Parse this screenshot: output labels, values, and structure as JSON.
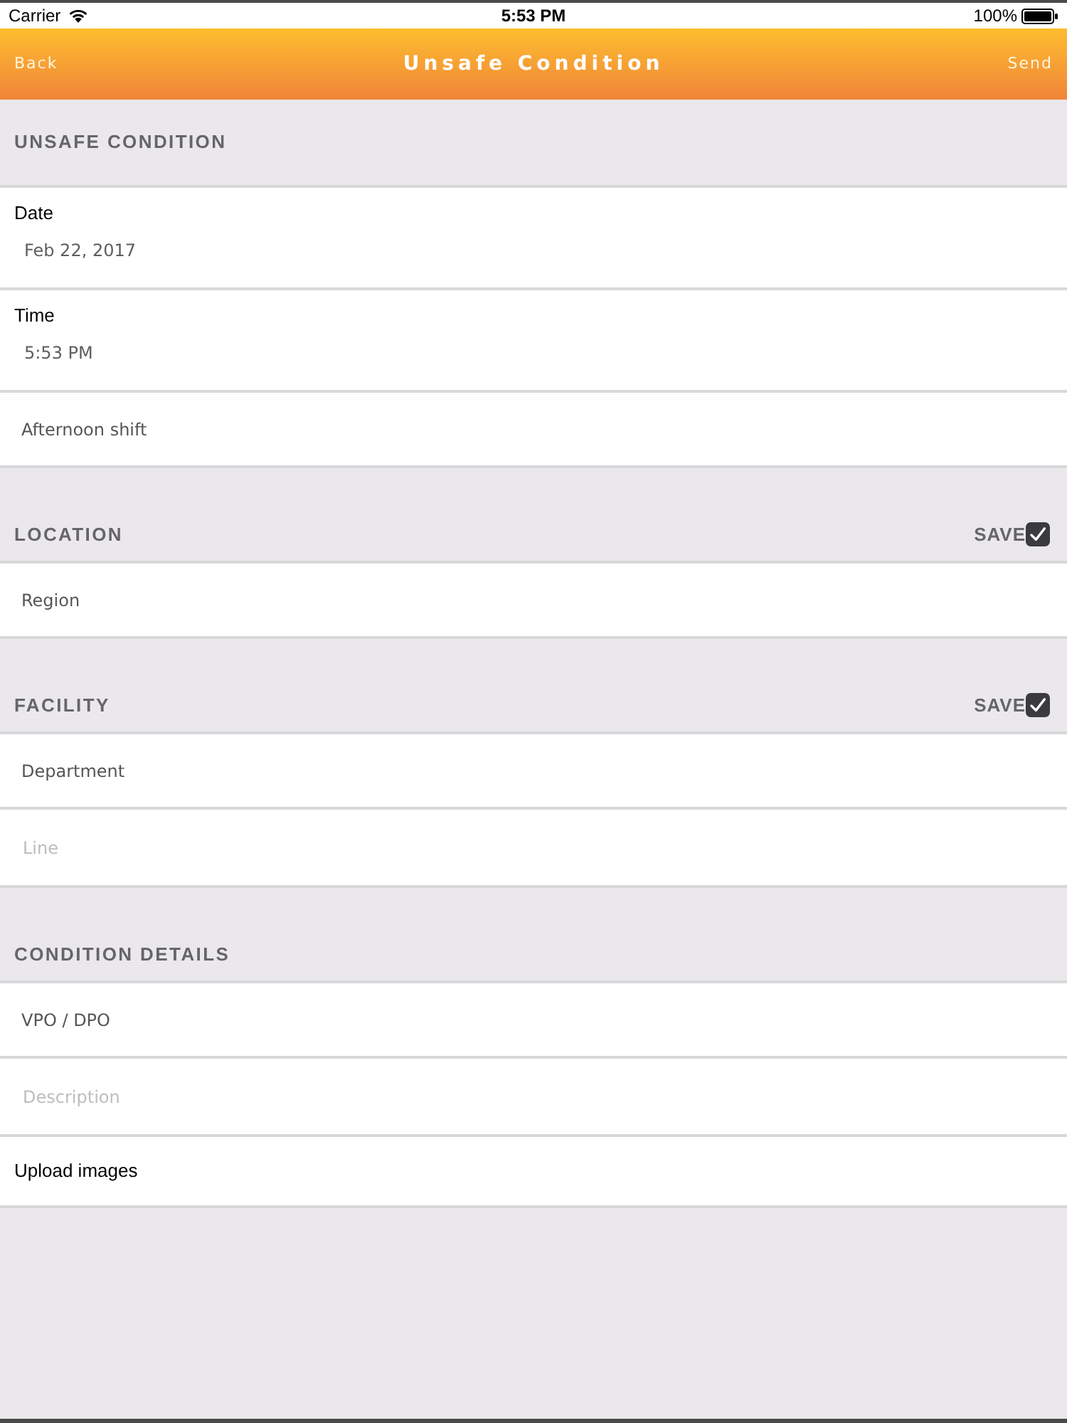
{
  "status_bar": {
    "carrier": "Carrier",
    "time": "5:53 PM",
    "battery": "100%"
  },
  "nav_bar": {
    "back": "Back",
    "title": "Unsafe Condition",
    "send": "Send"
  },
  "sections": [
    {
      "title": "UNSAFE CONDITION",
      "rows": [
        {
          "kind": "picker",
          "label": "Date",
          "value": "Feb 22, 2017"
        },
        {
          "kind": "picker",
          "label": "Time",
          "value": "5:53 PM"
        },
        {
          "kind": "select",
          "value": "Afternoon shift"
        }
      ]
    },
    {
      "title": "LOCATION",
      "save": {
        "label": "SAVE",
        "checked": true
      },
      "rows": [
        {
          "kind": "select",
          "value": "Region"
        }
      ]
    },
    {
      "title": "FACILITY",
      "save": {
        "label": "SAVE",
        "checked": true
      },
      "rows": [
        {
          "kind": "select",
          "value": "Department"
        },
        {
          "kind": "input",
          "placeholder": "Line"
        }
      ]
    },
    {
      "title": "CONDITION DETAILS",
      "rows": [
        {
          "kind": "select",
          "value": "VPO / DPO"
        },
        {
          "kind": "input",
          "placeholder": "Description"
        },
        {
          "kind": "action",
          "label": "Upload images"
        }
      ]
    }
  ]
}
